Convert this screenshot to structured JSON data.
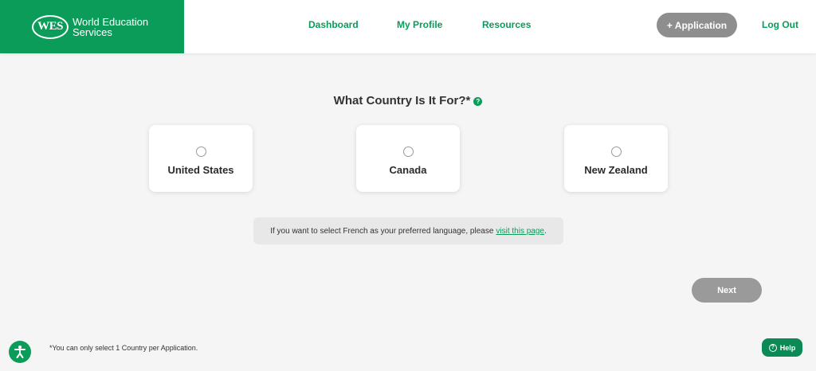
{
  "brand": {
    "logo_text": "WES",
    "name_line1": "World Education",
    "name_line2": "Services",
    "color": "#0b9c5a"
  },
  "nav": {
    "dashboard": "Dashboard",
    "my_profile": "My Profile",
    "resources": "Resources",
    "add_application": "+ Application",
    "log_out": "Log Out"
  },
  "question": {
    "title": "What Country Is It For?*",
    "help_icon": "question-circle-icon"
  },
  "countries": [
    {
      "label": "United States",
      "selected": false
    },
    {
      "label": "Canada",
      "selected": false
    },
    {
      "label": "New Zealand",
      "selected": false
    }
  ],
  "notice": {
    "text": "If you want to select French as your preferred language, please",
    "link": "visit this page",
    "suffix": "."
  },
  "next_label": "Next",
  "footnote": "*You can only select 1 Country per Application.",
  "help_label": "Help",
  "colors": {
    "accent": "#0b9c5a",
    "button_gray": "#8e8e8e",
    "background": "#f5f5f5"
  }
}
